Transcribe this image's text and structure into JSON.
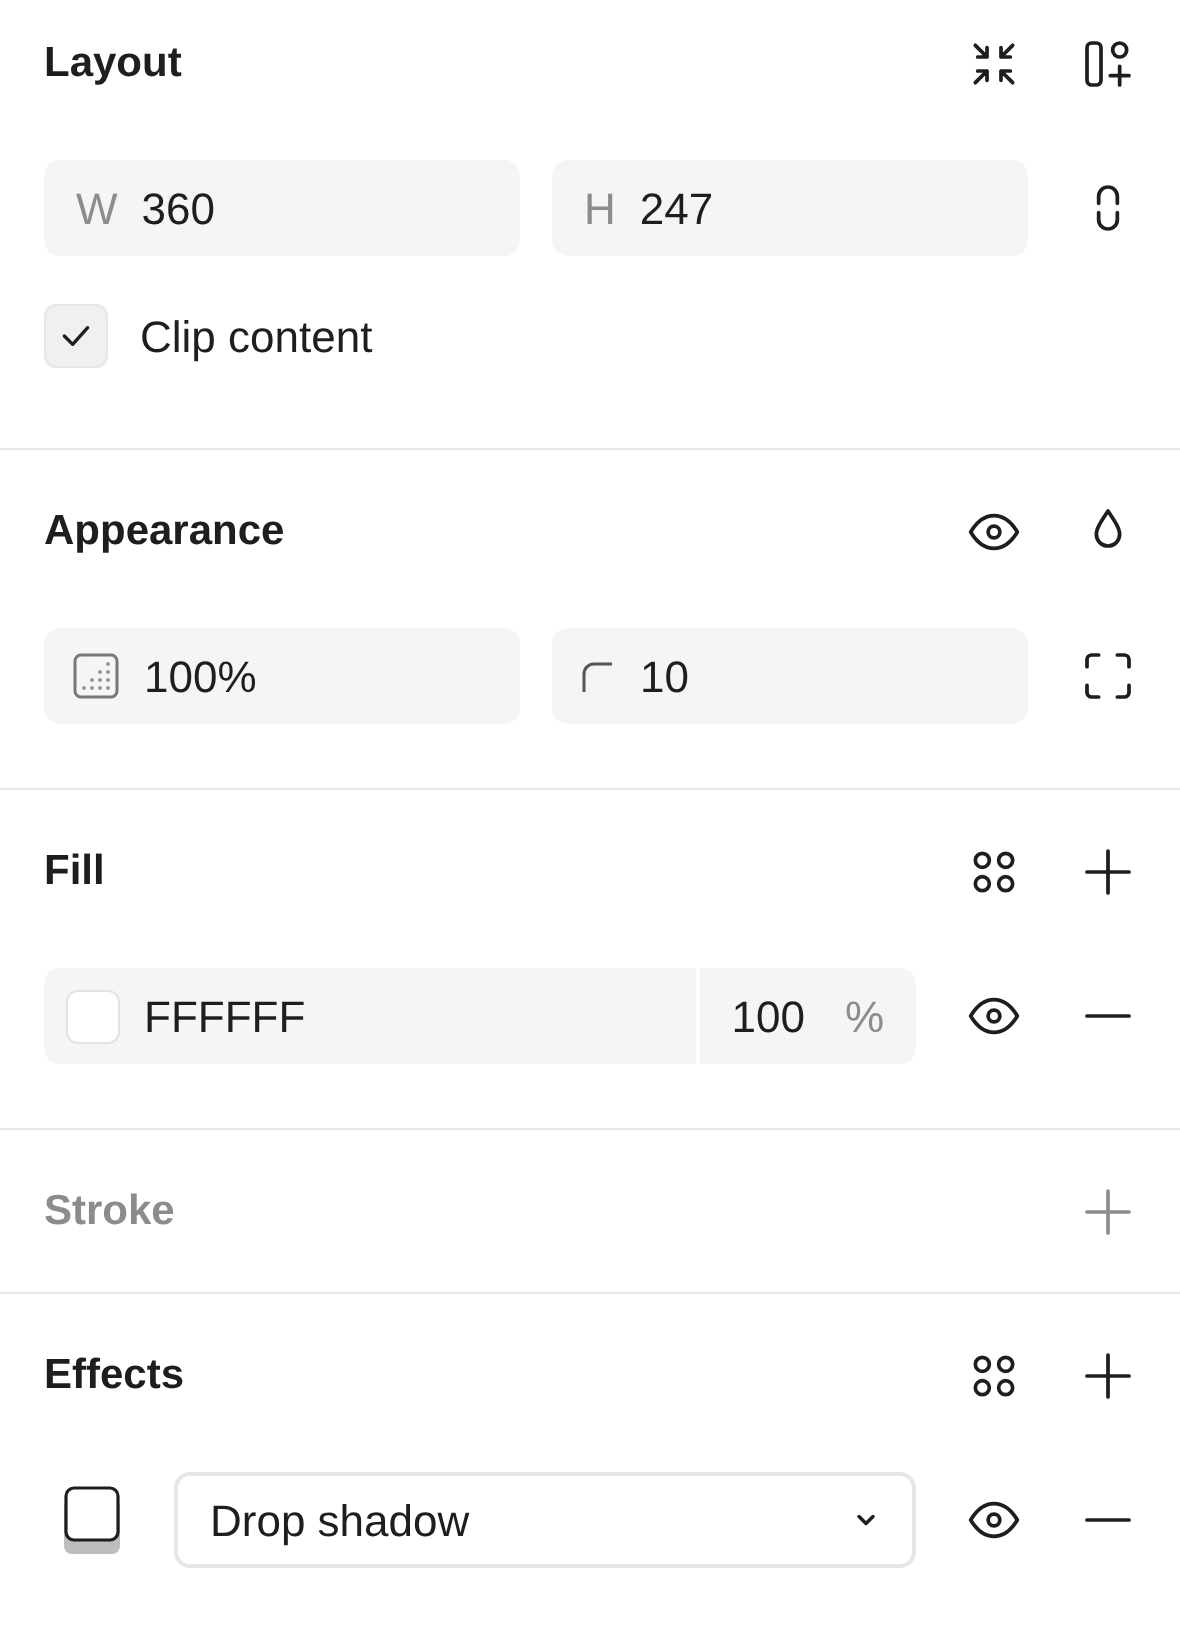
{
  "layout": {
    "title": "Layout",
    "width": {
      "label": "W",
      "value": "360"
    },
    "height": {
      "label": "H",
      "value": "247"
    },
    "clip_content": {
      "label": "Clip content",
      "checked": true
    }
  },
  "appearance": {
    "title": "Appearance",
    "opacity": "100%",
    "radius": "10"
  },
  "fill": {
    "title": "Fill",
    "hex": "FFFFFF",
    "opacity": "100",
    "unit": "%"
  },
  "stroke": {
    "title": "Stroke",
    "disabled": true
  },
  "effects": {
    "title": "Effects",
    "type": "Drop shadow"
  }
}
